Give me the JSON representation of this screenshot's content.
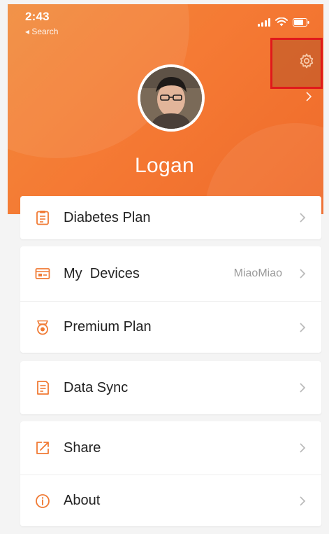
{
  "status_bar": {
    "time": "2:43",
    "back_label": "◂ Search"
  },
  "profile": {
    "name": "Logan"
  },
  "menu": {
    "diabetes_plan": {
      "label": "Diabetes Plan"
    },
    "my_devices": {
      "label": "My  Devices",
      "value": "MiaoMiao"
    },
    "premium_plan": {
      "label": "Premium Plan"
    },
    "data_sync": {
      "label": "Data Sync"
    },
    "share": {
      "label": "Share"
    },
    "about": {
      "label": "About"
    }
  },
  "colors": {
    "accent": "#f07a34",
    "highlight_border": "#e0191b"
  }
}
